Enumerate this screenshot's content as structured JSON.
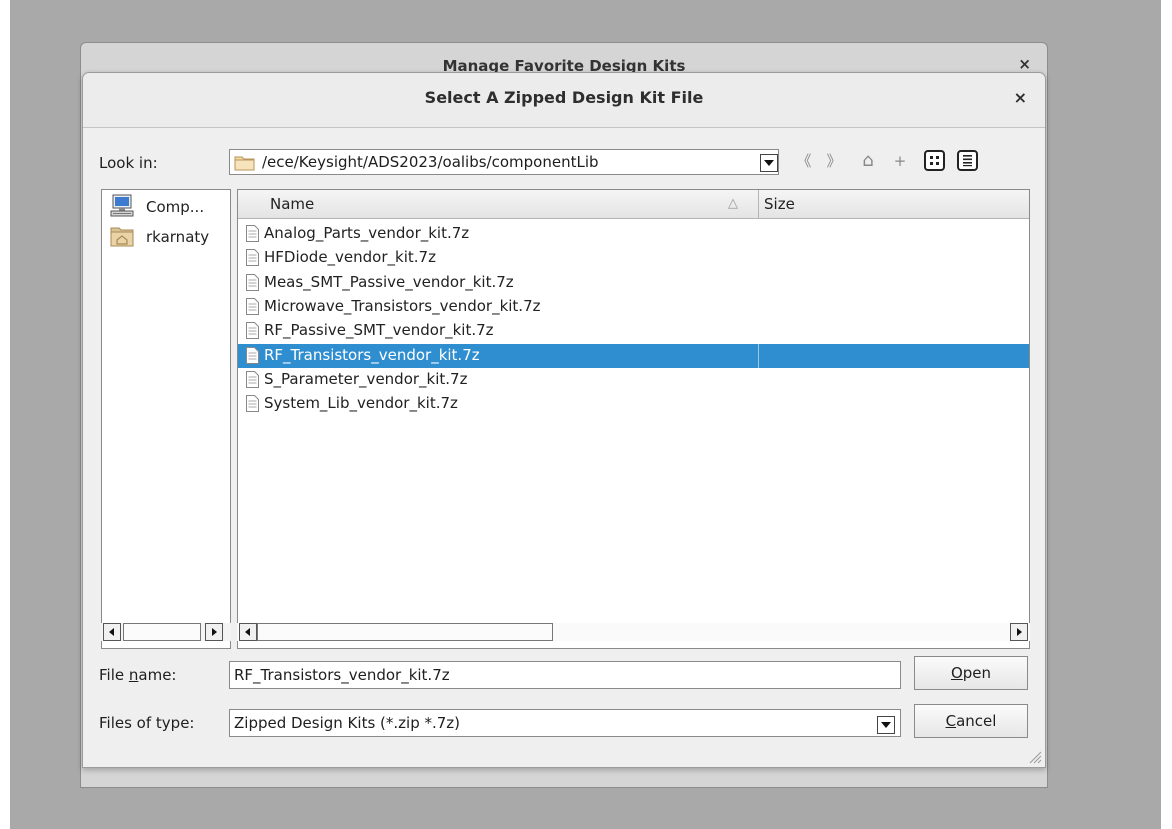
{
  "background_dialog": {
    "title": "Manage Favorite Design Kits",
    "close_glyph": "×"
  },
  "dialog": {
    "title": "Select A Zipped Design Kit File",
    "close_glyph": "×"
  },
  "look_in": {
    "label": "Look in:",
    "path": "/ece/Keysight/ADS2023/oalibs/componentLib",
    "folder_icon": "folder-icon"
  },
  "toolbar": {
    "back_glyph": "《",
    "forward_glyph": "》",
    "up_glyph": "⌂",
    "new_folder_glyph": "+",
    "icons": [
      "back-icon",
      "forward-icon",
      "parent-directory-icon",
      "new-folder-icon",
      "detail-view-icon",
      "list-view-icon"
    ]
  },
  "sidebar": {
    "items": [
      {
        "label": "Comp...",
        "icon": "computer-icon"
      },
      {
        "label": "rkarnaty",
        "icon": "home-folder-icon"
      }
    ]
  },
  "file_list": {
    "columns": [
      "Name",
      "Size"
    ],
    "sort_glyph": "△",
    "selected_index": 5,
    "files": [
      "Analog_Parts_vendor_kit.7z",
      "HFDiode_vendor_kit.7z",
      "Meas_SMT_Passive_vendor_kit.7z",
      "Microwave_Transistors_vendor_kit.7z",
      "RF_Passive_SMT_vendor_kit.7z",
      "RF_Transistors_vendor_kit.7z",
      "S_Parameter_vendor_kit.7z",
      "System_Lib_vendor_kit.7z"
    ]
  },
  "file_name": {
    "label_pre": "File ",
    "label_u": "n",
    "label_post": "ame:",
    "value": "RF_Transistors_vendor_kit.7z"
  },
  "file_type": {
    "label": "Files of type:",
    "value": "Zipped Design Kits (*.zip *.7z)"
  },
  "buttons": {
    "open_u": "O",
    "open_rest": "pen",
    "cancel_u": "C",
    "cancel_rest": "ancel"
  },
  "colors": {
    "selection": "#2f8ed0",
    "desktop": "#a9a9a9"
  }
}
